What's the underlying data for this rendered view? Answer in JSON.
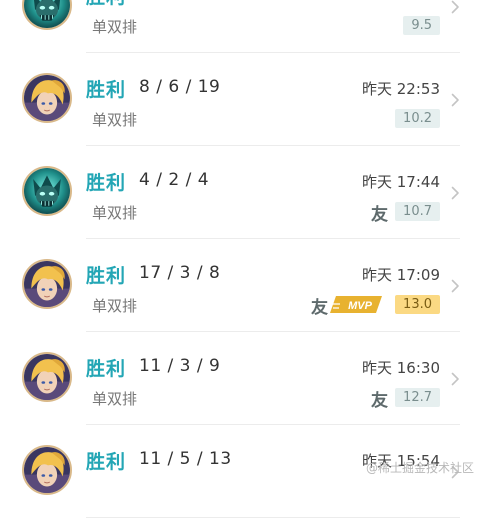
{
  "colors": {
    "win": "#23a6b5",
    "score_bg": "#e6efef",
    "mvp_bg": "#fbd983",
    "gold": "#e8b230"
  },
  "matches": [
    {
      "result": "胜利",
      "kda": "",
      "time": "",
      "mode": "单双排",
      "score": "9.5",
      "friend": false,
      "mvp": false,
      "hero": "green"
    },
    {
      "result": "胜利",
      "kda": "8 / 6 / 19",
      "time": "昨天 22:53",
      "mode": "单双排",
      "score": "10.2",
      "friend": false,
      "mvp": false,
      "hero": "blonde"
    },
    {
      "result": "胜利",
      "kda": "4 / 2 / 4",
      "time": "昨天 17:44",
      "mode": "单双排",
      "score": "10.7",
      "friend": true,
      "mvp": false,
      "hero": "green"
    },
    {
      "result": "胜利",
      "kda": "17 / 3 / 8",
      "time": "昨天 17:09",
      "mode": "单双排",
      "score": "13.0",
      "friend": true,
      "mvp": true,
      "hero": "blonde"
    },
    {
      "result": "胜利",
      "kda": "11 / 3 / 9",
      "time": "昨天 16:30",
      "mode": "单双排",
      "score": "12.7",
      "friend": true,
      "mvp": false,
      "hero": "blonde"
    },
    {
      "result": "胜利",
      "kda": "11 / 5 / 13",
      "time": "昨天 15:54",
      "mode": "",
      "score": "",
      "friend": false,
      "mvp": false,
      "hero": "blonde"
    }
  ],
  "labels": {
    "friend": "友",
    "mvp": "MVP"
  },
  "watermark": "@稀土掘金技术社区"
}
